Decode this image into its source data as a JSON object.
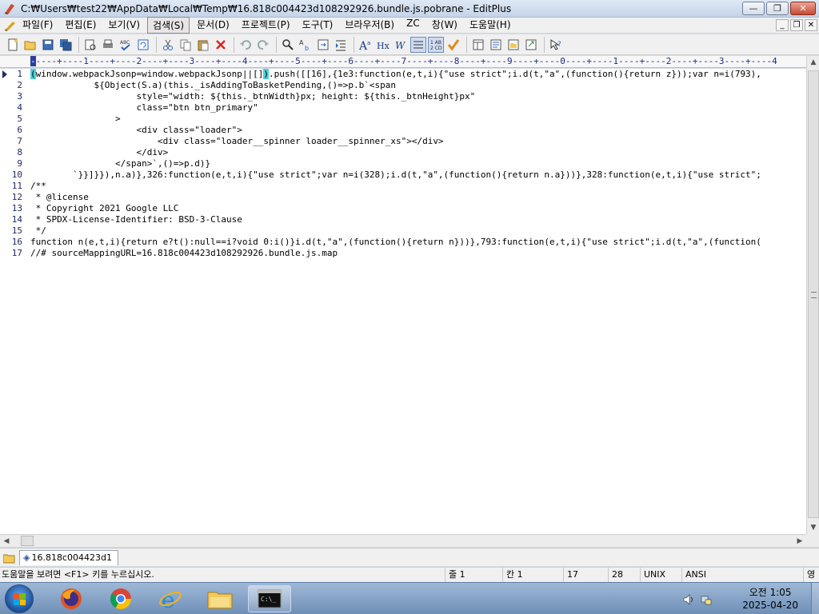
{
  "window": {
    "title": "C:₩Users₩test22₩AppData₩Local₩Temp₩16.818c004423d108292926.bundle.js.pobrane - EditPlus",
    "minimize": "—",
    "maximize": "❐",
    "close": "✕"
  },
  "menu": {
    "items": [
      "파일(F)",
      "편집(E)",
      "보기(V)",
      "검색(S)",
      "문서(D)",
      "프로젝트(P)",
      "도구(T)",
      "브라우저(B)",
      "ZC",
      "창(W)",
      "도움말(H)"
    ],
    "active_index": 3,
    "mdi": [
      "_",
      "❐",
      "✕"
    ]
  },
  "ruler": "----+----1----+----2----+----3----+----4----+----5----+----6----+----7----+----8----+----9----+----0----+----1----+----2----+----3----+----4",
  "editor": {
    "lines": [
      {
        "n": "1",
        "text": "(window.webpackJsonp=window.webpackJsonp||[]).push([[16],{1e3:function(e,t,i){\"use strict\";i.d(t,\"a\",(function(){return z}));var n=i(793),"
      },
      {
        "n": "2",
        "text": "            ${Object(S.a)(this._isAddingToBasketPending,()=>p.b`<span"
      },
      {
        "n": "3",
        "text": "                    style=\"width: ${this._btnWidth}px; height: ${this._btnHeight}px\""
      },
      {
        "n": "4",
        "text": "                    class=\"btn btn_primary\""
      },
      {
        "n": "5",
        "text": "                >"
      },
      {
        "n": "6",
        "text": "                    <div class=\"loader\">"
      },
      {
        "n": "7",
        "text": "                        <div class=\"loader__spinner loader__spinner_xs\"></div>"
      },
      {
        "n": "8",
        "text": "                    </div>"
      },
      {
        "n": "9",
        "text": "                </span>`,()=>p.d)}"
      },
      {
        "n": "10",
        "text": "        `}}]}}),n.a)},326:function(e,t,i){\"use strict\";var n=i(328);i.d(t,\"a\",(function(){return n.a}))},328:function(e,t,i){\"use strict\";"
      },
      {
        "n": "11",
        "text": "/**"
      },
      {
        "n": "12",
        "text": " * @license"
      },
      {
        "n": "13",
        "text": " * Copyright 2021 Google LLC"
      },
      {
        "n": "14",
        "text": " * SPDX-License-Identifier: BSD-3-Clause"
      },
      {
        "n": "15",
        "text": " */"
      },
      {
        "n": "16",
        "text": "function n(e,t,i){return e?t():null==i?void 0:i()}i.d(t,\"a\",(function(){return n}))},793:function(e,t,i){\"use strict\";i.d(t,\"a\",(function("
      },
      {
        "n": "17",
        "text": "//# sourceMappingURL=16.818c004423d108292926.bundle.js.map"
      }
    ]
  },
  "tab": {
    "label": "16.818c004423d1",
    "modified_mark": "◈"
  },
  "status": {
    "message": "도움말을 보려면 <F1> 키를 누르십시오.",
    "line": "줄 1",
    "col": "칸 1",
    "total_lines": "17",
    "field4": "28",
    "eol": "UNIX",
    "encoding": "ANSI",
    "lang": "영"
  },
  "clock": {
    "time": "오전 1:05",
    "date": "2025-04-20"
  },
  "icons": {
    "toolbar": [
      "new-file-icon",
      "open-folder-icon",
      "save-icon",
      "save-all-icon",
      "print-preview-icon",
      "print-icon",
      "spell-check-icon",
      "sync-icon",
      "cut-icon",
      "copy-icon",
      "paste-icon",
      "delete-icon",
      "undo-icon",
      "redo-icon",
      "find-icon",
      "replace-icon",
      "goto-icon",
      "indent-icon",
      "font-icon",
      "hex-icon",
      "word-wrap-icon",
      "line-number-icon",
      "ruler-icon",
      "check-icon",
      "browser-icon",
      "cliptext-icon",
      "directory-icon",
      "output-icon",
      "help-icon"
    ]
  },
  "colors": {
    "accent": "#4fd1d9",
    "line_number": "#1d2b6f"
  }
}
